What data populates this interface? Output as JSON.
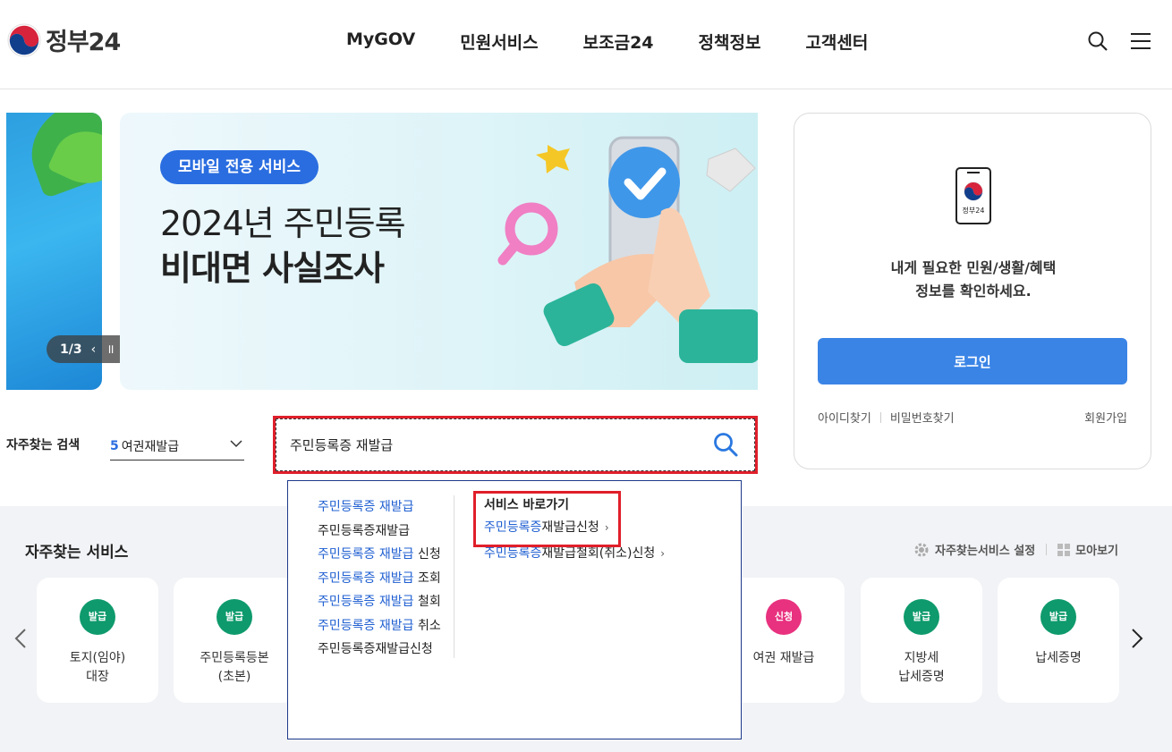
{
  "header": {
    "logo_text": "정부24",
    "nav": [
      "MyGOV",
      "민원서비스",
      "보조금24",
      "정책정보",
      "고객센터"
    ]
  },
  "banner": {
    "badge": "모바일 전용 서비스",
    "title_line1": "2024년 주민등록",
    "title_line2": "비대면 사실조사",
    "pager": "1/3"
  },
  "login": {
    "app_label": "정부24",
    "message_line1": "내게 필요한 민원/생활/혜택",
    "message_line2": "정보를 확인하세요.",
    "login_button": "로그인",
    "find_id": "아이디찾기",
    "find_pw": "비밀번호찾기",
    "join": "회원가입"
  },
  "frequent_search": {
    "label": "자주찾는 검색",
    "selected_rank": "5",
    "selected_text": "여권재발급"
  },
  "search": {
    "value": "주민등록증 재발급"
  },
  "autocomplete": {
    "suggestions": [
      {
        "highlight": "주민등록증 재발급",
        "rest": ""
      },
      {
        "highlight": "",
        "rest": "주민등록증재발급"
      },
      {
        "highlight": "주민등록증 재발급",
        "rest": " 신청"
      },
      {
        "highlight": "주민등록증 재발급",
        "rest": " 조회"
      },
      {
        "highlight": "주민등록증 재발급",
        "rest": " 철회"
      },
      {
        "highlight": "주민등록증 재발급",
        "rest": " 취소"
      },
      {
        "highlight": "",
        "rest": "주민등록증재발급신청"
      }
    ],
    "shortcut_title": "서비스 바로가기",
    "shortcuts": [
      {
        "highlight": "주민등록증",
        "rest": "재발급신청",
        "arrow": "›"
      },
      {
        "highlight": "주민등록증",
        "rest": "재발급철회(취소)신청",
        "arrow": "›"
      }
    ]
  },
  "frequent_services": {
    "title": "자주찾는 서비스",
    "settings": "자주찾는서비스 설정",
    "view_all": "모아보기",
    "cards": [
      {
        "tag": "발급",
        "line1": "토지(임야)",
        "line2": "대장",
        "color": "#0e9a6c"
      },
      {
        "tag": "발급",
        "line1": "주민등록등본",
        "line2": "(초본)",
        "color": "#0e9a6c"
      },
      {
        "tag": "신청",
        "line1": "여권 재발급",
        "line2": "",
        "color": "#e8317f"
      },
      {
        "tag": "발급",
        "line1": "지방세",
        "line2": "납세증명",
        "color": "#0e9a6c"
      },
      {
        "tag": "발급",
        "line1": "납세증명",
        "line2": "",
        "color": "#0e9a6c"
      }
    ]
  },
  "colors": {
    "brand_blue": "#3a84e6",
    "highlight_red": "#e01f2b",
    "link_blue": "#1f5fd1"
  }
}
